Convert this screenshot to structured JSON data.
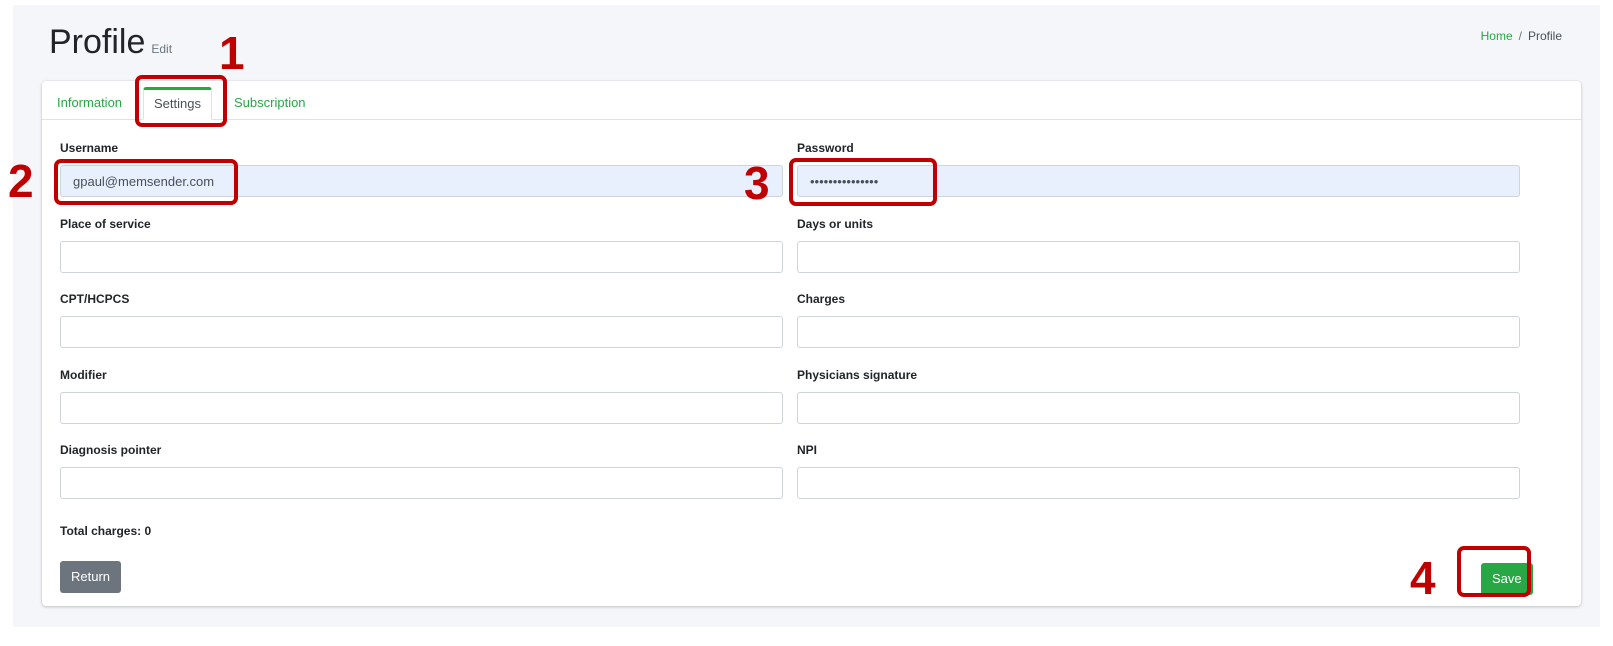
{
  "header": {
    "title": "Profile",
    "subtitle": "Edit"
  },
  "breadcrumb": {
    "home": "Home",
    "separator": "/",
    "current": "Profile"
  },
  "tabs": [
    {
      "label": "Information",
      "active": false
    },
    {
      "label": "Settings",
      "active": true
    },
    {
      "label": "Subscription",
      "active": false
    }
  ],
  "form": {
    "username": {
      "label": "Username",
      "value": "gpaul@memsender.com"
    },
    "password": {
      "label": "Password",
      "value": "•••••••••••••••"
    },
    "place_of_service": {
      "label": "Place of service",
      "value": ""
    },
    "days_or_units": {
      "label": "Days or units",
      "value": ""
    },
    "cpt_hcpcs": {
      "label": "CPT/HCPCS",
      "value": ""
    },
    "charges": {
      "label": "Charges",
      "value": ""
    },
    "modifier": {
      "label": "Modifier",
      "value": ""
    },
    "physicians_signature": {
      "label": "Physicians signature",
      "value": ""
    },
    "diagnosis_pointer": {
      "label": "Diagnosis pointer",
      "value": ""
    },
    "npi": {
      "label": "NPI",
      "value": ""
    }
  },
  "total_charges": "Total charges: 0",
  "buttons": {
    "return_label": "Return",
    "save_label": "Save"
  },
  "annotations": [
    "1",
    "2",
    "3",
    "4"
  ],
  "colors": {
    "accent": "#28a745",
    "annotation": "#c00000",
    "return_button": "#6c757d",
    "autofill_bg": "#e8f0fe"
  }
}
